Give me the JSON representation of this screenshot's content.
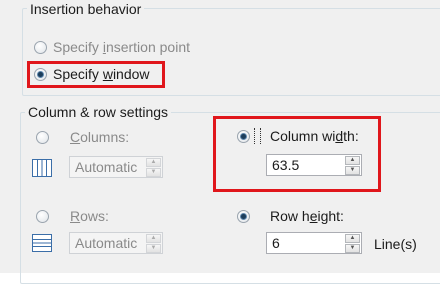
{
  "insertion": {
    "legend": "Insertion behavior",
    "option_point": {
      "pre": "Specify ",
      "u": "i",
      "post": "nsertion point"
    },
    "option_window": {
      "pre": "Specify ",
      "u": "w",
      "post": "indow"
    }
  },
  "colrow": {
    "legend": "Column & row settings",
    "columns_label": {
      "pre": "",
      "u": "C",
      "post": "olumns:"
    },
    "columns_value": "Automatic",
    "column_width_label": {
      "pre": "Column wi",
      "u": "d",
      "post": "th:"
    },
    "column_width_value": "63.5",
    "rows_label": {
      "pre": "",
      "u": "R",
      "post": "ows:"
    },
    "rows_value": "Automatic",
    "row_height_label": {
      "pre": "Row h",
      "u": "e",
      "post": "ight:"
    },
    "row_height_value": "6",
    "row_height_unit": "Line(s)"
  },
  "spin_up_glyph": "▲",
  "spin_down_glyph": "▼",
  "highlight_color": "#e0161b"
}
